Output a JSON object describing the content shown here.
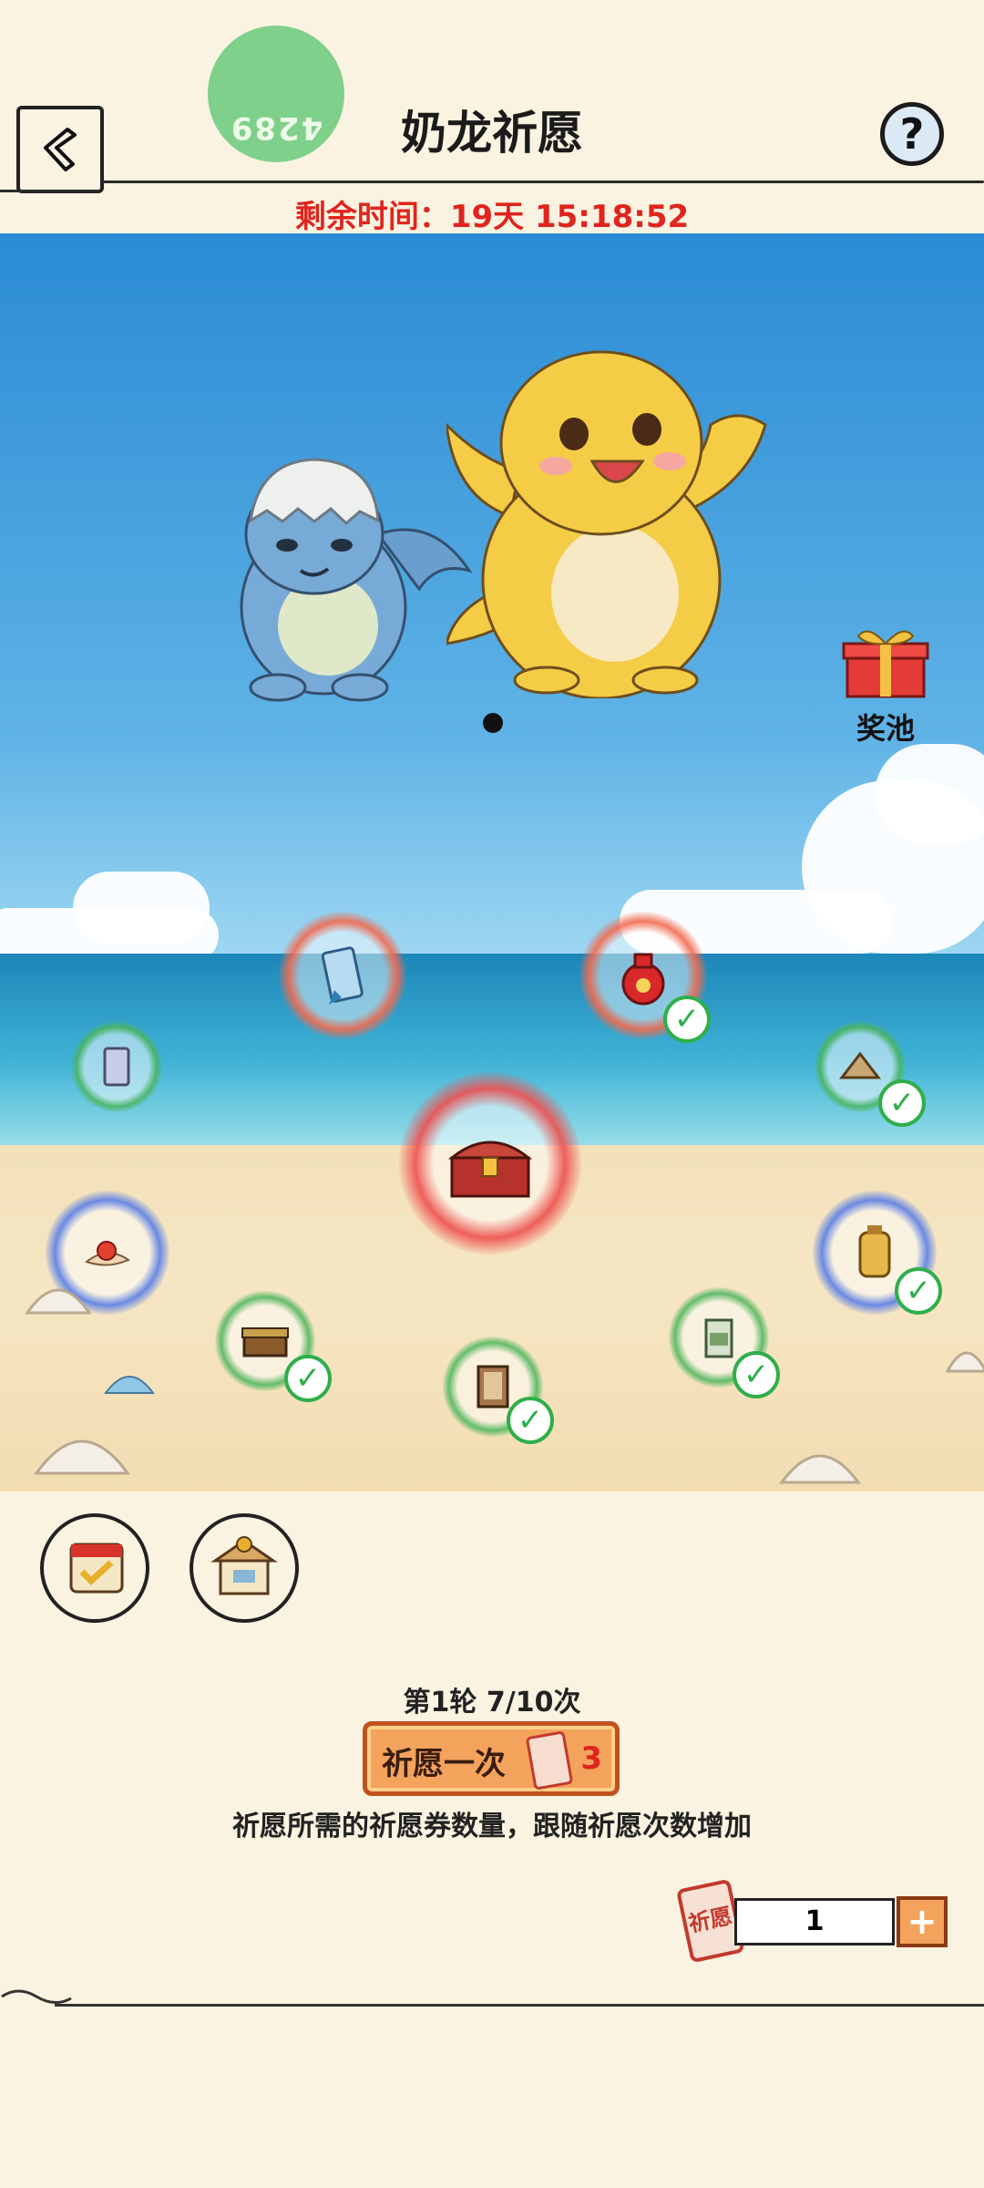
{
  "header": {
    "title": "奶龙祈愿",
    "badge_text": "4289",
    "help_label": "?",
    "timer_text": "剩余时间：19天 15:18:52"
  },
  "scene": {
    "prize_pool_label": "奖池"
  },
  "footer": {
    "round_text": "第1轮 7/10次",
    "wish_button_label": "祈愿一次",
    "wish_cost": "3",
    "info_text": "祈愿所需的祈愿券数量，跟随祈愿次数增加",
    "ticket_text": "祈愿",
    "quantity": "1",
    "plus_label": "+"
  },
  "colors": {
    "timer": "#e0241e",
    "ring_red": "#f26b50",
    "ring_green": "#4ab55b",
    "ring_blue": "#5b7fe6",
    "check": "#2fae4a"
  },
  "nodes": [
    {
      "name": "ticket-node",
      "ring": "green",
      "icon": "ticket-icon",
      "claimed": false
    },
    {
      "name": "pendant-node",
      "ring": "red",
      "icon": "pendant-icon",
      "claimed": false
    },
    {
      "name": "money-bag-node",
      "ring": "red",
      "icon": "money-bag-icon",
      "claimed": true
    },
    {
      "name": "fan-node",
      "ring": "green",
      "icon": "fan-icon",
      "claimed": true
    },
    {
      "name": "treasure-chest-node",
      "ring": "red",
      "icon": "treasure-chest-icon",
      "claimed": false
    },
    {
      "name": "orb-node",
      "ring": "blue",
      "icon": "orb-icon",
      "claimed": false
    },
    {
      "name": "lantern-node",
      "ring": "blue",
      "icon": "lantern-icon",
      "claimed": true
    },
    {
      "name": "box-node",
      "ring": "green",
      "icon": "box-icon",
      "claimed": true
    },
    {
      "name": "book-node",
      "ring": "green",
      "icon": "book-icon",
      "claimed": true
    },
    {
      "name": "bag-node",
      "ring": "green",
      "icon": "bag-icon",
      "claimed": true
    }
  ]
}
